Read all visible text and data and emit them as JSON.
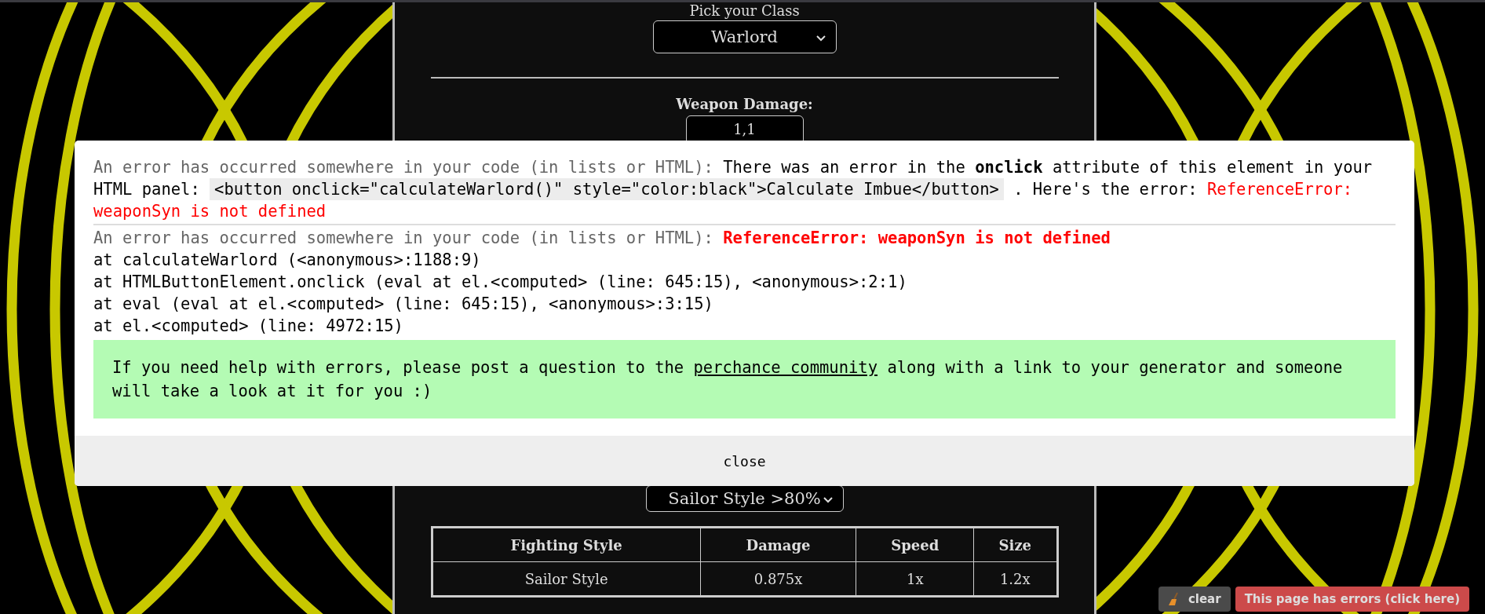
{
  "page": {
    "title": "Pick your Class",
    "class_select": {
      "value": "Warlord"
    },
    "weapon_damage": {
      "label": "Weapon Damage:",
      "value": "1,1"
    },
    "style_select": {
      "value": "Sailor Style >80%"
    },
    "table": {
      "columns": [
        "Fighting Style",
        "Damage",
        "Speed",
        "Size"
      ],
      "rows": [
        [
          "Sailor Style",
          "0.875x",
          "1x",
          "1.2x"
        ]
      ]
    }
  },
  "error_dialog": {
    "first": {
      "prefix": "An error has occurred somewhere in your code (in lists or HTML):",
      "message": "There was an error in the **onclick** attribute of this element in your HTML panel:",
      "code": "<button onclick=\"calculateWarlord()\" style=\"color:black\">Calculate Imbue</button>",
      "suffix": ". Here's the error:",
      "error": "ReferenceError: weaponSyn is not defined"
    },
    "second": {
      "prefix": "An error has occurred somewhere in your code (in lists or HTML):",
      "error": "ReferenceError: weaponSyn is not defined",
      "stack": [
        "at calculateWarlord (<anonymous>:1188:9)",
        "at HTMLButtonElement.onclick (eval at el.<computed> (line: 645:15), <anonymous>:2:1)",
        "at eval (eval at el.<computed> (line: 645:15), <anonymous>:3:15)",
        "at el.<computed> (line: 4972:15)"
      ]
    },
    "help": {
      "before": "If you need help with errors, please post a question to the",
      "link": "perchance community",
      "after": "along with a link to your generator and someone will take a look at it for you :)"
    },
    "close": "close"
  },
  "error_bar": {
    "clear": "clear",
    "errors": "This page has errors (click here)"
  }
}
